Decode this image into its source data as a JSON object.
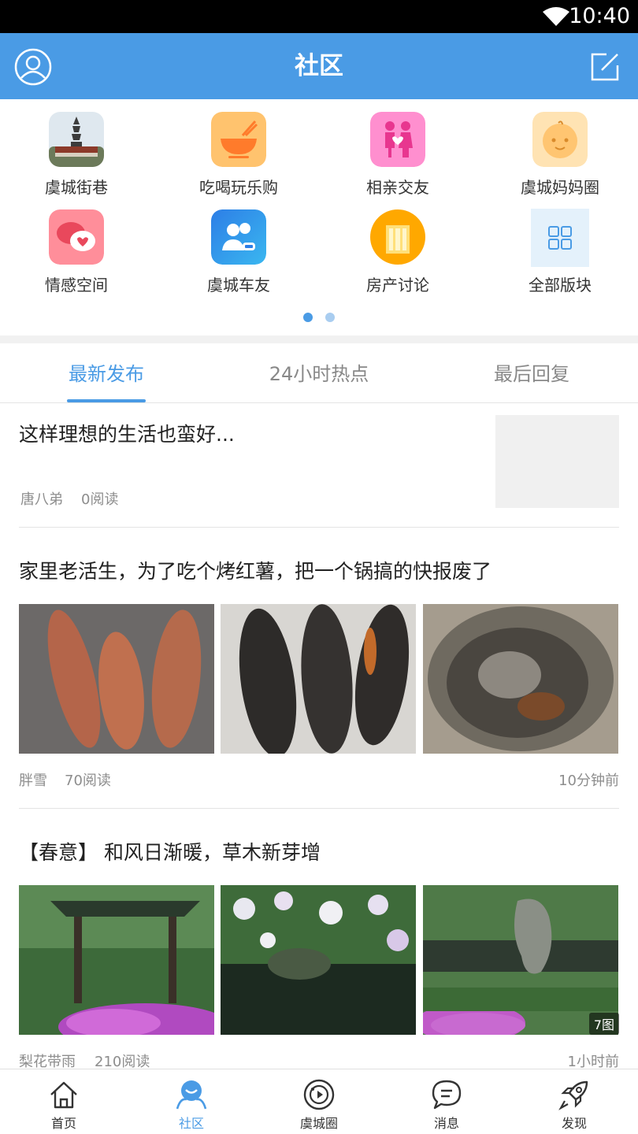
{
  "status_bar": {
    "time": "10:40"
  },
  "header": {
    "title": "社区"
  },
  "categories": [
    {
      "label": "虞城街巷",
      "icon": "pagoda-photo-icon"
    },
    {
      "label": "吃喝玩乐购",
      "icon": "food-bowl-icon"
    },
    {
      "label": "相亲交友",
      "icon": "couple-icon"
    },
    {
      "label": "虞城妈妈圈",
      "icon": "baby-face-icon"
    },
    {
      "label": "情感空间",
      "icon": "heart-chat-icon"
    },
    {
      "label": "虞城车友",
      "icon": "car-friends-icon"
    },
    {
      "label": "房产讨论",
      "icon": "building-icon"
    },
    {
      "label": "全部版块",
      "icon": "grid-icon"
    }
  ],
  "pager": {
    "pages": 2,
    "current": 1
  },
  "tabs": [
    {
      "label": "最新发布",
      "active": true
    },
    {
      "label": "24小时热点",
      "active": false
    },
    {
      "label": "最后回复",
      "active": false
    }
  ],
  "posts": [
    {
      "title": "这样理想的生活也蛮好...",
      "author": "唐八弟",
      "reads": "0阅读",
      "time": ""
    },
    {
      "title": "家里老活生，为了吃个烤红薯，把一个锅搞的快报废了",
      "author": "胖雪",
      "reads": "70阅读",
      "time": "10分钟前"
    },
    {
      "title": "【春意】 和风日渐暖，草木新芽增",
      "author": "梨花带雨",
      "reads": "210阅读",
      "time": "1小时前",
      "image_badge": "7图"
    }
  ],
  "bottom_nav": [
    {
      "label": "首页",
      "icon": "home-icon",
      "active": false
    },
    {
      "label": "社区",
      "icon": "community-icon",
      "active": true
    },
    {
      "label": "虞城圈",
      "icon": "circle-icon",
      "active": false
    },
    {
      "label": "消息",
      "icon": "message-icon",
      "active": false
    },
    {
      "label": "发现",
      "icon": "rocket-icon",
      "active": false
    }
  ],
  "colors": {
    "accent": "#4a9be5",
    "header_bg": "#4a9be5",
    "meta_text": "#8d8d8d"
  }
}
